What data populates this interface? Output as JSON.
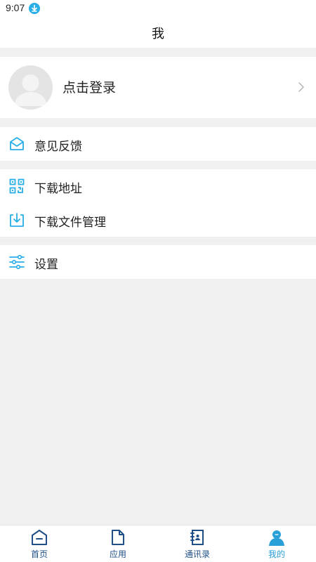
{
  "status_bar": {
    "time": "9:07"
  },
  "header": {
    "title": "我"
  },
  "profile": {
    "login_label": "点击登录"
  },
  "menu": {
    "feedback": "意见反馈",
    "download_address": "下载地址",
    "download_manager": "下载文件管理",
    "settings": "设置"
  },
  "tabs": [
    {
      "label": "首页",
      "icon": "home-icon"
    },
    {
      "label": "应用",
      "icon": "document-icon"
    },
    {
      "label": "通讯录",
      "icon": "contacts-icon"
    },
    {
      "label": "我的",
      "icon": "user-icon",
      "active": true
    }
  ],
  "colors": {
    "accent": "#29aee6",
    "tab_icon": "#1f4f86",
    "background": "#f0f0f0"
  }
}
